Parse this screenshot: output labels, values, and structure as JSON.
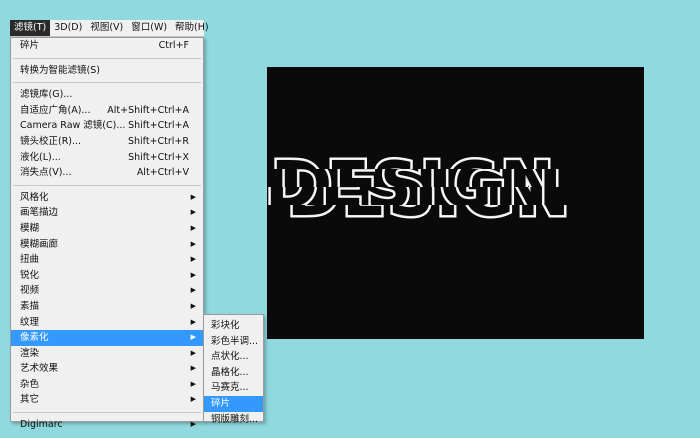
{
  "menubar": {
    "items": [
      "滤镜(T)",
      "3D(D)",
      "视图(V)",
      "窗口(W)",
      "帮助(H)"
    ],
    "active": 0
  },
  "filter_menu": {
    "recent": {
      "label": "碎片",
      "shortcut": "Ctrl+F"
    },
    "smart": {
      "label": "转换为智能滤镜(S)"
    },
    "group1": [
      {
        "label": "滤镜库(G)...",
        "shortcut": ""
      },
      {
        "label": "自适应广角(A)...",
        "shortcut": "Alt+Shift+Ctrl+A"
      },
      {
        "label": "Camera Raw 滤镜(C)...",
        "shortcut": "Shift+Ctrl+A"
      },
      {
        "label": "镜头校正(R)...",
        "shortcut": "Shift+Ctrl+R"
      },
      {
        "label": "液化(L)...",
        "shortcut": "Shift+Ctrl+X"
      },
      {
        "label": "消失点(V)...",
        "shortcut": "Alt+Ctrl+V"
      }
    ],
    "group2": [
      {
        "label": "风格化"
      },
      {
        "label": "画笔描边"
      },
      {
        "label": "模糊"
      },
      {
        "label": "模糊画廊"
      },
      {
        "label": "扭曲"
      },
      {
        "label": "锐化"
      },
      {
        "label": "视频"
      },
      {
        "label": "素描"
      },
      {
        "label": "纹理"
      },
      {
        "label": "像素化"
      },
      {
        "label": "渲染"
      },
      {
        "label": "艺术效果"
      },
      {
        "label": "杂色"
      },
      {
        "label": "其它"
      }
    ],
    "highlighted": "像素化",
    "digimarc": {
      "label": "Digimarc"
    },
    "submenu_arrow": "▶"
  },
  "pixelate_submenu": {
    "items": [
      "彩块化",
      "彩色半调...",
      "点状化...",
      "晶格化...",
      "马赛克...",
      "碎片",
      "铜版雕刻..."
    ],
    "highlighted": "碎片"
  },
  "canvas": {
    "text": "DESIGN",
    "background": "#0a0a0a",
    "text_color": "#ffffff"
  },
  "colors": {
    "desktop": "#8fd9df",
    "menu_bg": "#f0f0f0",
    "highlight": "#3399ff"
  }
}
